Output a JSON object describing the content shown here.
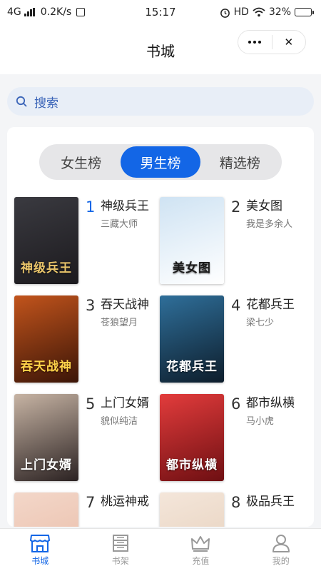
{
  "status_bar": {
    "network": "4G",
    "speed": "0.2K/s",
    "time": "15:17",
    "hd": "HD",
    "battery": "32%",
    "battery_level": 0.32
  },
  "nav": {
    "title": "书城",
    "more_icon": "more-dots-icon",
    "close_icon": "close-icon",
    "close_glyph": "✕"
  },
  "search": {
    "placeholder": "搜索",
    "icon": "search-icon"
  },
  "tabs": [
    {
      "label": "女生榜",
      "active": false
    },
    {
      "label": "男生榜",
      "active": true
    },
    {
      "label": "精选榜",
      "active": false
    }
  ],
  "books": [
    {
      "rank": "1",
      "title": "神级兵王",
      "author": "三藏大师",
      "cover_text": "神级兵王",
      "cover_colors": [
        "#3a3a40",
        "#1c1a1e"
      ],
      "cover_text_color": "#e9c46a"
    },
    {
      "rank": "2",
      "title": "美女图",
      "author": "我是多余人",
      "cover_text": "美女图",
      "cover_colors": [
        "#cfe3f3",
        "#ffffff"
      ],
      "cover_text_color": "#1a1a1a"
    },
    {
      "rank": "3",
      "title": "吞天战神",
      "author": "苍狼望月",
      "cover_text": "吞天战神",
      "cover_colors": [
        "#c2541c",
        "#3b1507"
      ],
      "cover_text_color": "#ffd34a"
    },
    {
      "rank": "4",
      "title": "花都兵王",
      "author": "梁七少",
      "cover_text": "花都兵王",
      "cover_colors": [
        "#2f6f9a",
        "#0d1d2b"
      ],
      "cover_text_color": "#ffffff"
    },
    {
      "rank": "5",
      "title": "上门女婿",
      "author": "貌似纯洁",
      "cover_text": "上门女婿",
      "cover_colors": [
        "#c7b4a4",
        "#2b2222"
      ],
      "cover_text_color": "#ffffff"
    },
    {
      "rank": "6",
      "title": "都市纵横",
      "author": "马小虎",
      "cover_text": "都市纵横",
      "cover_colors": [
        "#e33c3c",
        "#6e0f12"
      ],
      "cover_text_color": "#ffffff"
    },
    {
      "rank": "7",
      "title": "桃运神戒",
      "author": "",
      "cover_text": "",
      "cover_colors": [
        "#f3d7c9",
        "#e8b9a4"
      ],
      "cover_text_color": "#ffffff"
    },
    {
      "rank": "8",
      "title": "极品兵王",
      "author": "",
      "cover_text": "",
      "cover_colors": [
        "#f4e6da",
        "#e4cdb8"
      ],
      "cover_text_color": "#ffffff"
    }
  ],
  "bottom_tabs": [
    {
      "label": "书城",
      "icon": "store-icon",
      "active": true
    },
    {
      "label": "书架",
      "icon": "bookshelf-icon",
      "active": false
    },
    {
      "label": "充值",
      "icon": "crown-icon",
      "active": false
    },
    {
      "label": "我的",
      "icon": "profile-icon",
      "active": false
    }
  ],
  "colors": {
    "accent": "#1366e6",
    "search_bg": "#e8eef7",
    "tab_track": "#e6e6e8"
  }
}
